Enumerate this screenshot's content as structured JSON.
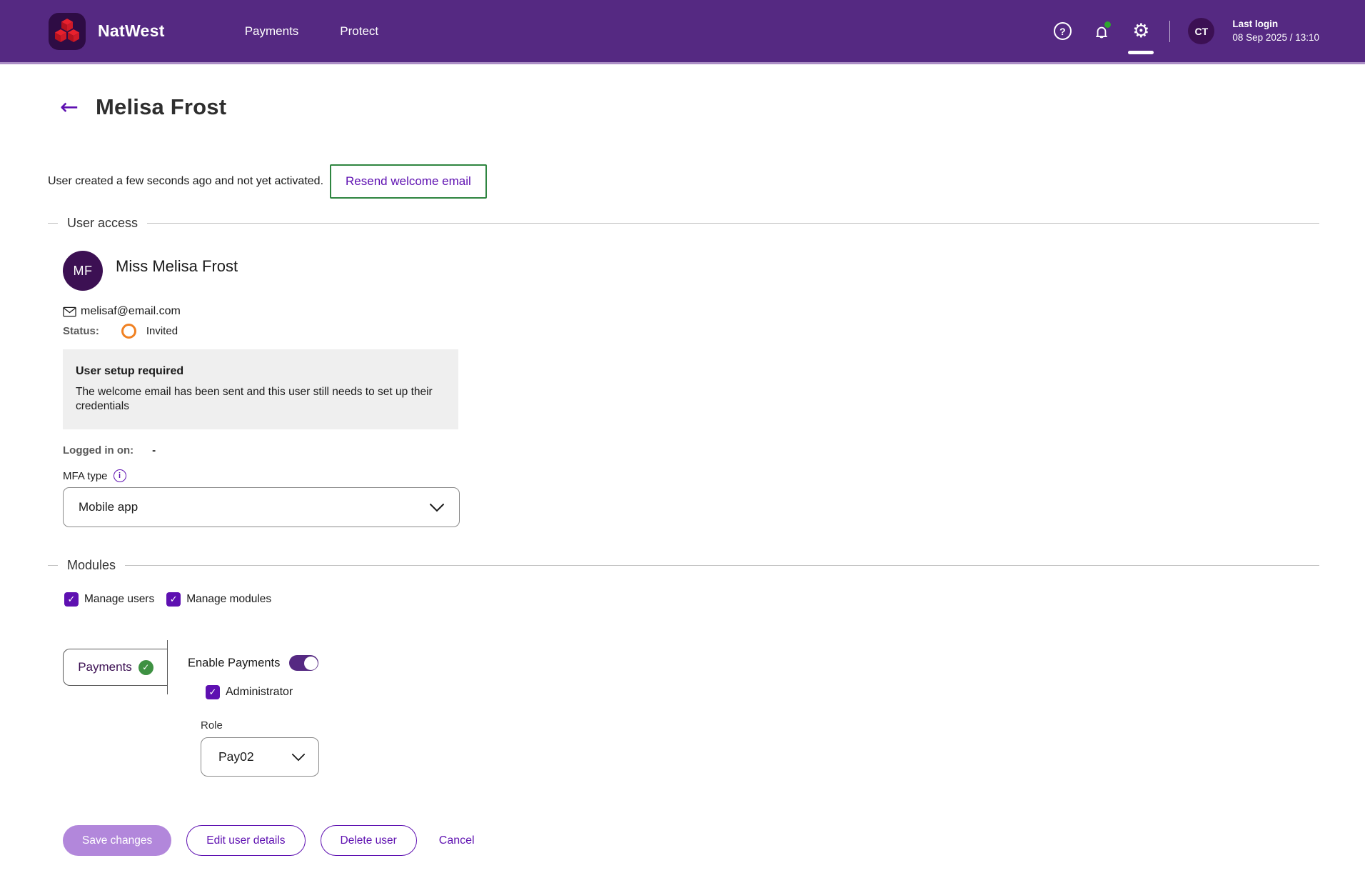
{
  "header": {
    "brand": "NatWest",
    "nav": [
      {
        "label": "Payments"
      },
      {
        "label": "Protect"
      }
    ],
    "avatar_initials": "CT",
    "last_login_label": "Last login",
    "last_login_value": "08 Sep 2025 / 13:10"
  },
  "icons": {
    "help": "?",
    "gear": "⚙",
    "back_arrow": "←",
    "info": "i",
    "check": "✓"
  },
  "page": {
    "title": "Melisa Frost",
    "notice": "User created a few seconds ago and not yet activated.",
    "resend_button": "Resend welcome email"
  },
  "user_access": {
    "section_title": "User access",
    "avatar_initials": "MF",
    "full_name": "Miss Melisa Frost",
    "email": "melisaf@email.com",
    "status_label": "Status:",
    "status_value": "Invited",
    "setup_box": {
      "title": "User setup required",
      "body": "The welcome email has been sent and this user still needs to set up their credentials"
    },
    "logged_in_label": "Logged in on:",
    "logged_in_value": "-",
    "mfa_label": "MFA type",
    "mfa_value": "Mobile app"
  },
  "modules": {
    "section_title": "Modules",
    "checkboxes": [
      {
        "label": "Manage users",
        "checked": true
      },
      {
        "label": "Manage modules",
        "checked": true
      }
    ],
    "tab_label": "Payments",
    "enable_label": "Enable Payments",
    "enable_on": true,
    "admin_label": "Administrator",
    "admin_checked": true,
    "role_label": "Role",
    "role_value": "Pay02"
  },
  "actions": {
    "save": "Save changes",
    "edit": "Edit user details",
    "delete": "Delete user",
    "cancel": "Cancel"
  },
  "colors": {
    "brand_purple": "#552982",
    "dark_purple": "#3C1053",
    "accent_purple": "#5E10B1",
    "light_purple_button": "#B287DB",
    "focus_green": "#2E8540",
    "success_green": "#3E9142",
    "status_orange": "#F08122",
    "notification_green": "#2FA52F",
    "header_underline": "#AB8EC5"
  }
}
